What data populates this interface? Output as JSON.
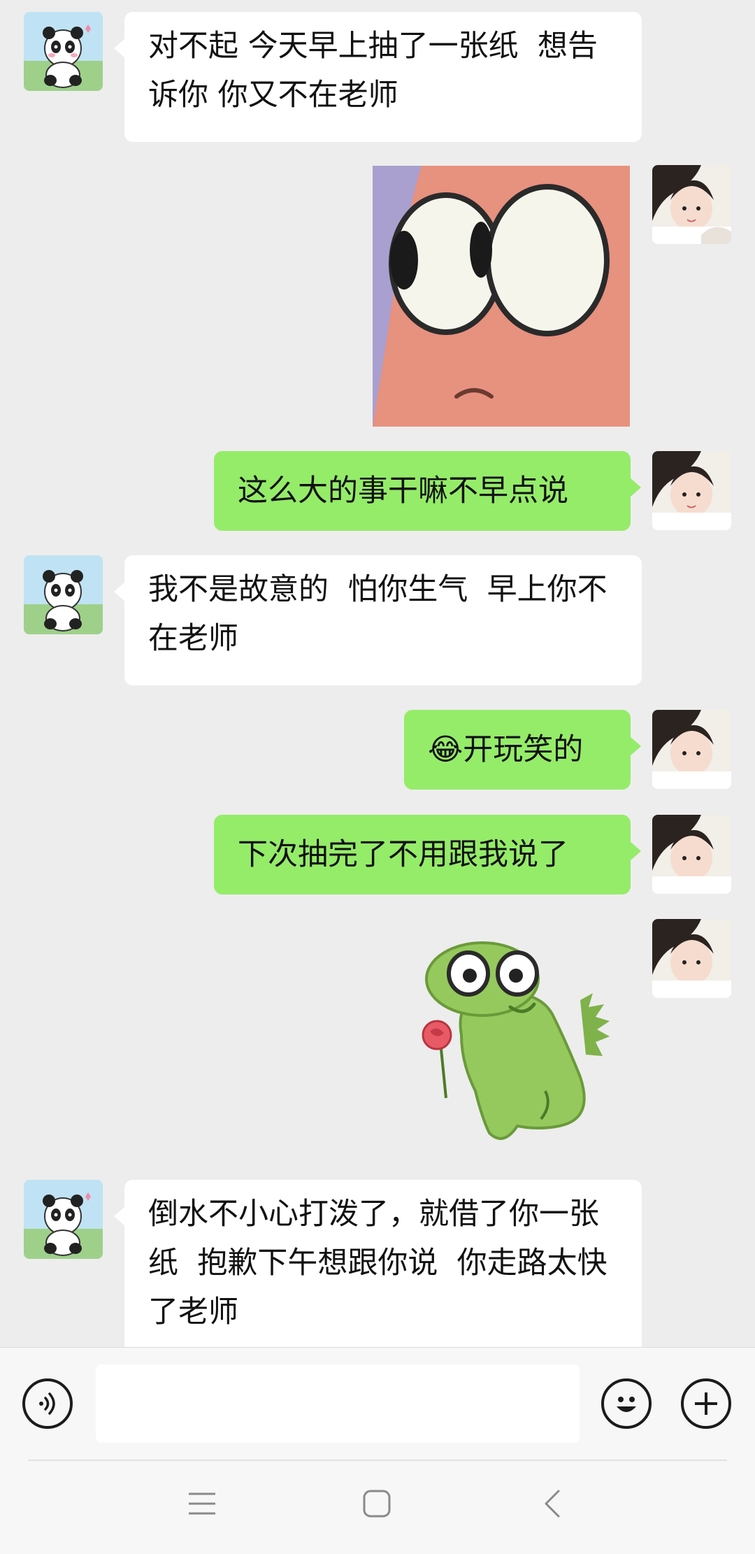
{
  "messages": [
    {
      "side": "left",
      "type": "text",
      "text": "对不起 今天早上抽了一张纸  想告诉你 你又不在老师"
    },
    {
      "side": "right",
      "type": "sticker",
      "sticker": "patrick-star-eyes-sticker"
    },
    {
      "side": "right",
      "type": "text",
      "text": "这么大的事干嘛不早点说"
    },
    {
      "side": "left",
      "type": "text",
      "text": "我不是故意的  怕你生气  早上你不在老师"
    },
    {
      "side": "right",
      "type": "text",
      "text": "😂开玩笑的"
    },
    {
      "side": "right",
      "type": "text",
      "text": "下次抽完了不用跟我说了"
    },
    {
      "side": "right",
      "type": "sticker",
      "sticker": "green-dinosaur-rose-sticker"
    },
    {
      "side": "left",
      "type": "text",
      "text": "倒水不小心打泼了，就借了你一张纸  抱歉下午想跟你说  你走路太快了老师"
    }
  ],
  "input_bar": {
    "voice_icon": "voice-icon",
    "emoji_icon": "emoji-icon",
    "plus_icon": "plus-icon",
    "text_value": ""
  },
  "nav_bar": {
    "menu_icon": "menu-icon",
    "home_icon": "home-icon",
    "back_icon": "back-icon"
  },
  "colors": {
    "background": "#ededed",
    "sent_bubble": "#95ec69",
    "received_bubble": "#ffffff"
  }
}
